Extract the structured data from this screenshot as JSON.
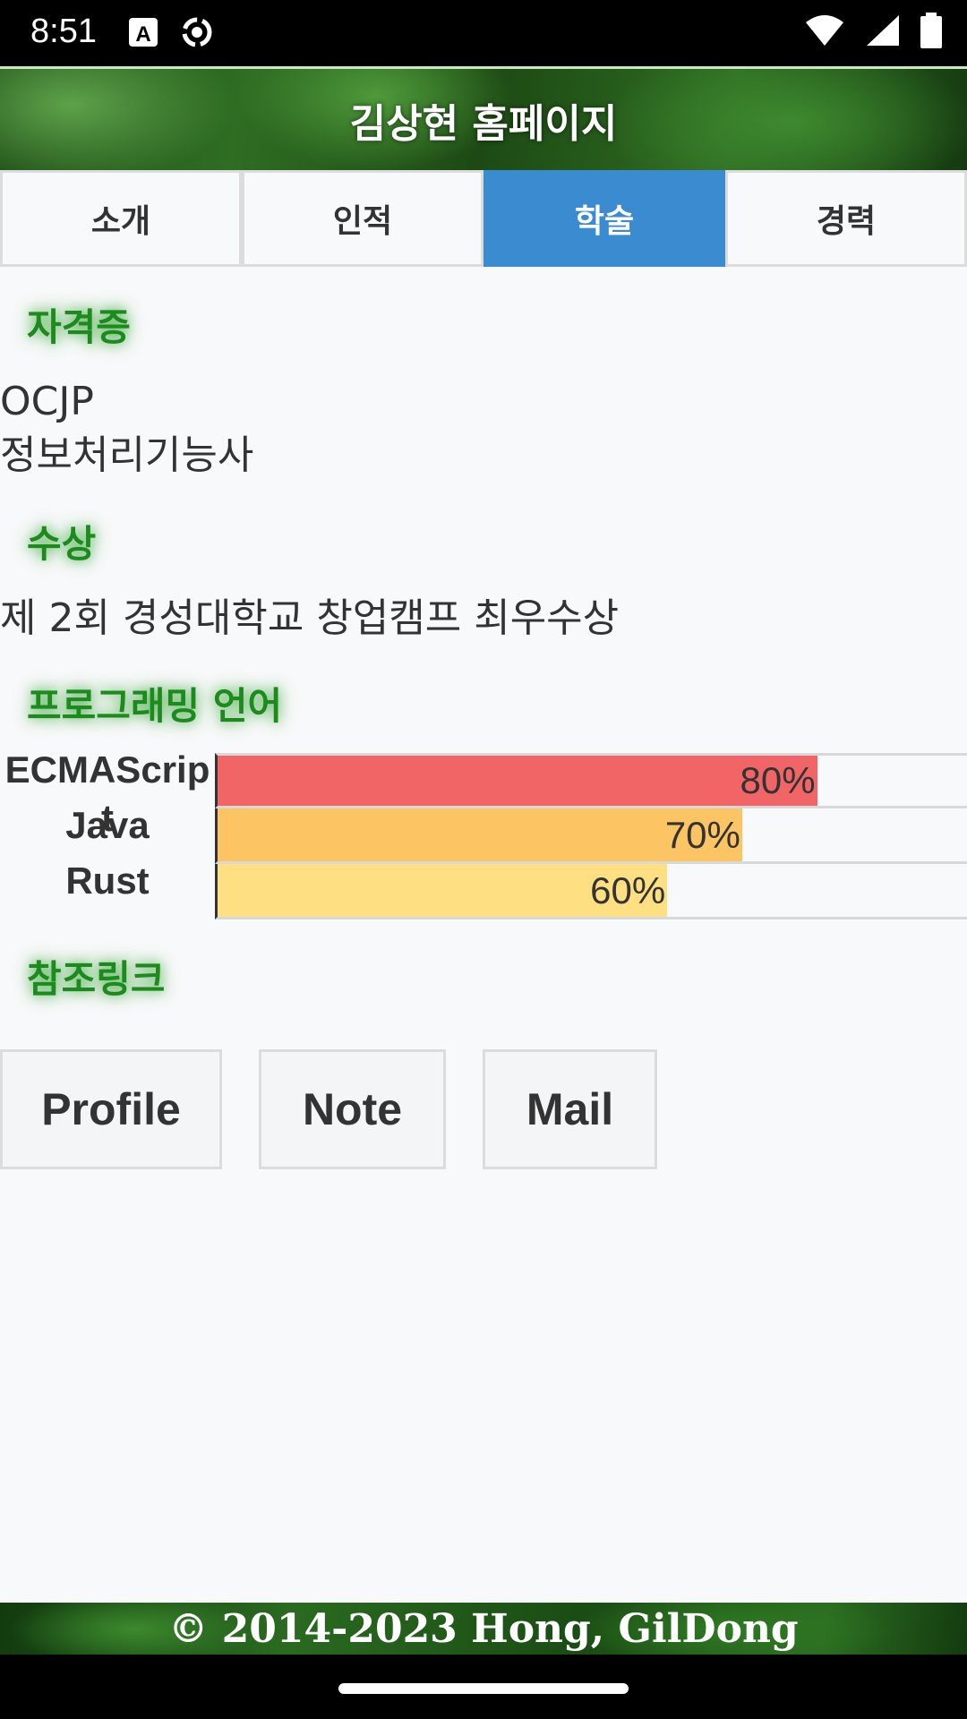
{
  "status_bar": {
    "time": "8:51",
    "icons_left": [
      "a-notification-icon",
      "sync-icon"
    ],
    "icons_right": [
      "wifi-icon",
      "signal-icon",
      "battery-icon"
    ]
  },
  "header": {
    "title": "김상현 홈페이지"
  },
  "tabs": [
    {
      "label": "소개",
      "active": false
    },
    {
      "label": "인적",
      "active": false
    },
    {
      "label": "학술",
      "active": true
    },
    {
      "label": "경력",
      "active": false
    }
  ],
  "sections": {
    "certificates": {
      "heading": "자격증",
      "items": [
        "OCJP",
        "정보처리기능사"
      ]
    },
    "awards": {
      "heading": "수상",
      "items": [
        "제 2회 경성대학교 창업캠프 최우수상"
      ]
    },
    "languages": {
      "heading": "프로그래밍 언어",
      "skills": [
        {
          "name": "ECMAScript",
          "percent": 80,
          "label": "80%",
          "color": "#f26566"
        },
        {
          "name": "Java",
          "percent": 70,
          "label": "70%",
          "color": "#fdc463"
        },
        {
          "name": "Rust",
          "percent": 60,
          "label": "60%",
          "color": "#fee083"
        }
      ]
    },
    "links": {
      "heading": "참조링크",
      "buttons": [
        "Profile",
        "Note",
        "Mail"
      ]
    }
  },
  "footer": {
    "text": "© 2014-2023 Hong, GilDong"
  },
  "colors": {
    "accent": "#3a8bd0",
    "heading_green": "#1c8a1c"
  }
}
